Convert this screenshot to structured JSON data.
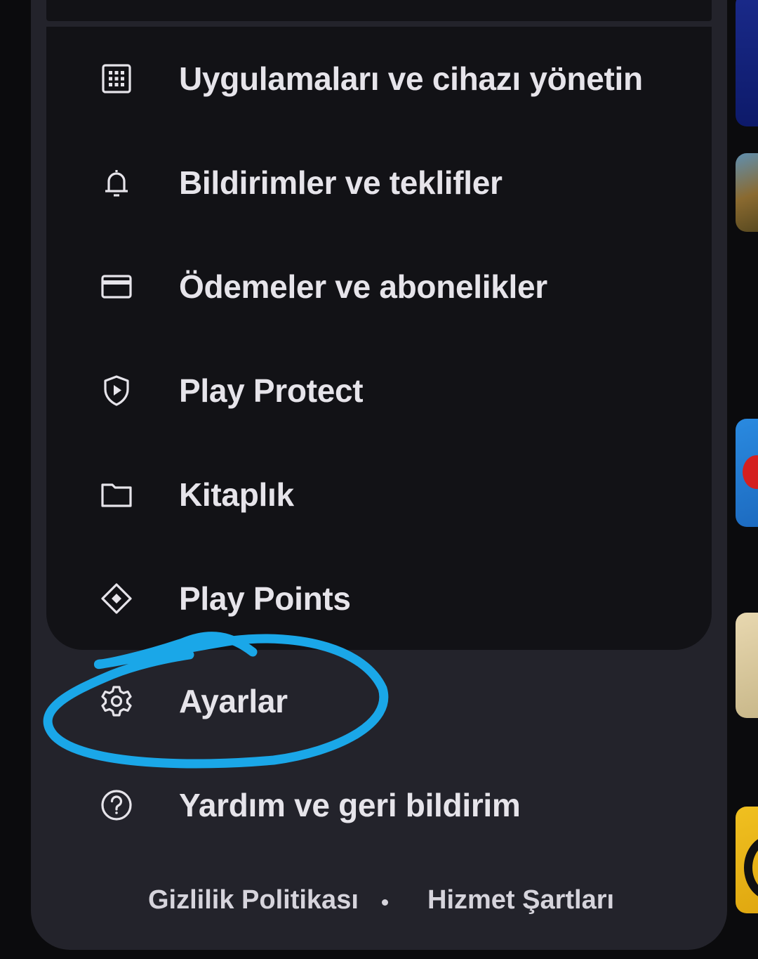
{
  "menu": {
    "items": [
      {
        "label": "Uygulamaları ve cihazı yönetin",
        "icon": "grid-icon"
      },
      {
        "label": "Bildirimler ve teklifler",
        "icon": "bell-icon"
      },
      {
        "label": "Ödemeler ve abonelikler",
        "icon": "credit-card-icon"
      },
      {
        "label": "Play Protect",
        "icon": "shield-play-icon"
      },
      {
        "label": "Kitaplık",
        "icon": "folder-icon"
      },
      {
        "label": "Play Points",
        "icon": "diamond-icon"
      }
    ],
    "settings": {
      "label": "Ayarlar",
      "icon": "gear-icon"
    },
    "help": {
      "label": "Yardım ve geri bildirim",
      "icon": "help-circle-icon"
    }
  },
  "footer": {
    "privacy": "Gizlilik Politikası",
    "terms": "Hizmet Şartları"
  },
  "annotation": {
    "color": "#1aa7e8"
  },
  "colors": {
    "sheet": "#23232b",
    "card": "#121216",
    "text": "#e6e4ea"
  }
}
